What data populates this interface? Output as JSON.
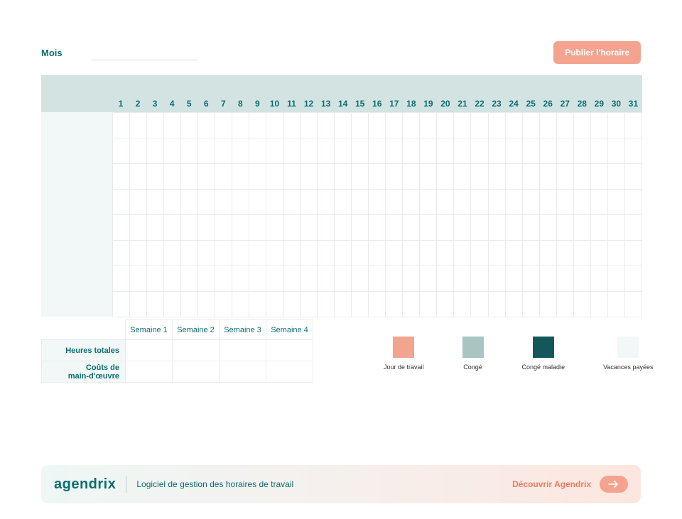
{
  "header": {
    "month_label": "Mois",
    "month_value": "",
    "publish_label": "Publier l'horaire"
  },
  "calendar": {
    "days": [
      "1",
      "2",
      "3",
      "4",
      "5",
      "6",
      "7",
      "8",
      "9",
      "10",
      "11",
      "12",
      "13",
      "14",
      "15",
      "16",
      "17",
      "18",
      "19",
      "20",
      "21",
      "22",
      "23",
      "24",
      "25",
      "26",
      "27",
      "28",
      "29",
      "30",
      "31"
    ],
    "rows": 8
  },
  "summary": {
    "weeks": [
      "Semaine 1",
      "Semaine 2",
      "Semaine 3",
      "Semaine 4"
    ],
    "rows": [
      {
        "label": "Heures totales",
        "values": [
          "",
          "",
          "",
          ""
        ]
      },
      {
        "label": "Coûts de\nmain-d'œuvre",
        "values": [
          "",
          "",
          "",
          ""
        ]
      }
    ]
  },
  "legend": [
    {
      "label": "Jour de travail",
      "color": "#f1a58f"
    },
    {
      "label": "Congé",
      "color": "#a9c5c3"
    },
    {
      "label": "Congé maladie",
      "color": "#13575b"
    },
    {
      "label": "Vacances payées",
      "color": "#f1f8f7"
    }
  ],
  "footer": {
    "brand": "agendrix",
    "tagline": "Logiciel de gestion des horaires de travail",
    "discover": "Découvrir Agendrix"
  }
}
